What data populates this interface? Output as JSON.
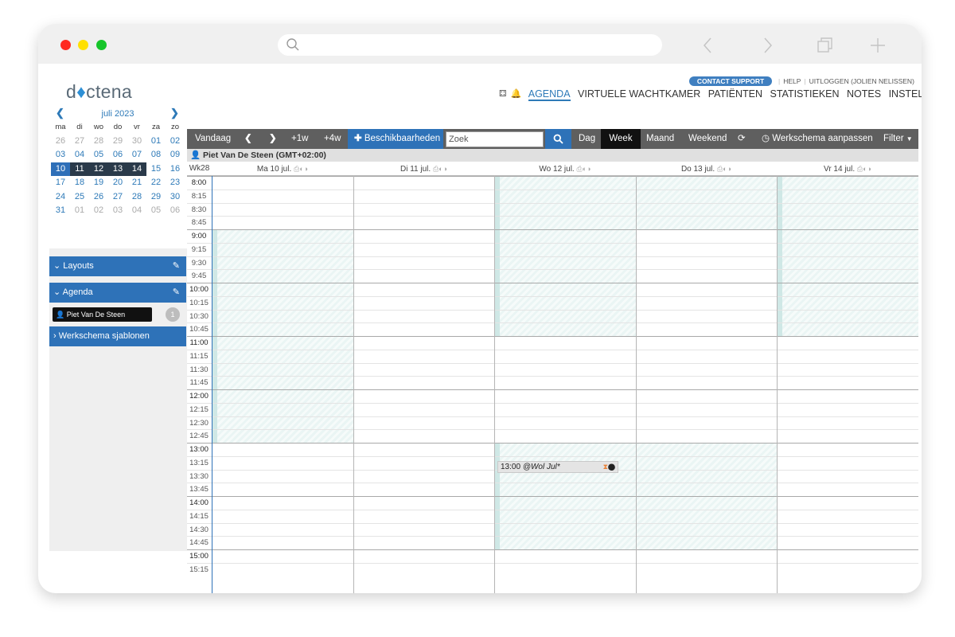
{
  "app": {
    "logo_text_pre": "d",
    "logo_text_post": "ctena",
    "support_label": "CONTACT SUPPORT",
    "help_label": "HELP",
    "logout_label": "UITLOGGEN (JOLIEN NELISSEN)",
    "nav": [
      "AGENDA",
      "VIRTUELE WACHTKAMER",
      "PATIËNTEN",
      "STATISTIEKEN",
      "NOTES",
      "INSTELLINGEN"
    ],
    "nav_active": "AGENDA"
  },
  "minical": {
    "title": "juli 2023",
    "dow": [
      "ma",
      "di",
      "wo",
      "do",
      "vr",
      "za",
      "zo"
    ],
    "weeks": [
      [
        "26",
        "27",
        "28",
        "29",
        "30",
        "01",
        "02"
      ],
      [
        "03",
        "04",
        "05",
        "06",
        "07",
        "08",
        "09"
      ],
      [
        "10",
        "11",
        "12",
        "13",
        "14",
        "15",
        "16"
      ],
      [
        "17",
        "18",
        "19",
        "20",
        "21",
        "22",
        "23"
      ],
      [
        "24",
        "25",
        "26",
        "27",
        "28",
        "29",
        "30"
      ],
      [
        "31",
        "01",
        "02",
        "03",
        "04",
        "05",
        "06"
      ]
    ]
  },
  "sidebar": {
    "layouts_label": "Layouts",
    "agenda_label": "Agenda",
    "agenda_person": "Piet Van De Steen",
    "agenda_badge": "1",
    "templates_label": "Werkschema sjablonen"
  },
  "toolbar": {
    "today": "Vandaag",
    "plus1w": "+1w",
    "plus4w": "+4w",
    "availability": "Beschikbaarheden",
    "search_placeholder": "Zoek",
    "view_day": "Dag",
    "view_week": "Week",
    "view_month": "Maand",
    "view_weekend": "Weekend",
    "edit_schedule": "Werkschema aanpassen",
    "filter": "Filter"
  },
  "calendar": {
    "doctor_row": "Piet Van De Steen (GMT+02:00)",
    "week_label": "Wk28",
    "days": [
      "Ma 10 jul.",
      "Di 11 jul.",
      "Wo 12 jul.",
      "Do 13 jul.",
      "Vr 14 jul."
    ],
    "times": [
      "8:00",
      "8:15",
      "8:30",
      "8:45",
      "9:00",
      "9:15",
      "9:30",
      "9:45",
      "10:00",
      "10:15",
      "10:30",
      "10:45",
      "11:00",
      "11:15",
      "11:30",
      "11:45",
      "12:00",
      "12:15",
      "12:30",
      "12:45",
      "13:00",
      "13:15",
      "13:30",
      "13:45",
      "14:00",
      "14:15",
      "14:30",
      "14:45",
      "15:00",
      "15:15"
    ],
    "event": {
      "time": "13:00",
      "title": "@Wol Jul*"
    }
  }
}
